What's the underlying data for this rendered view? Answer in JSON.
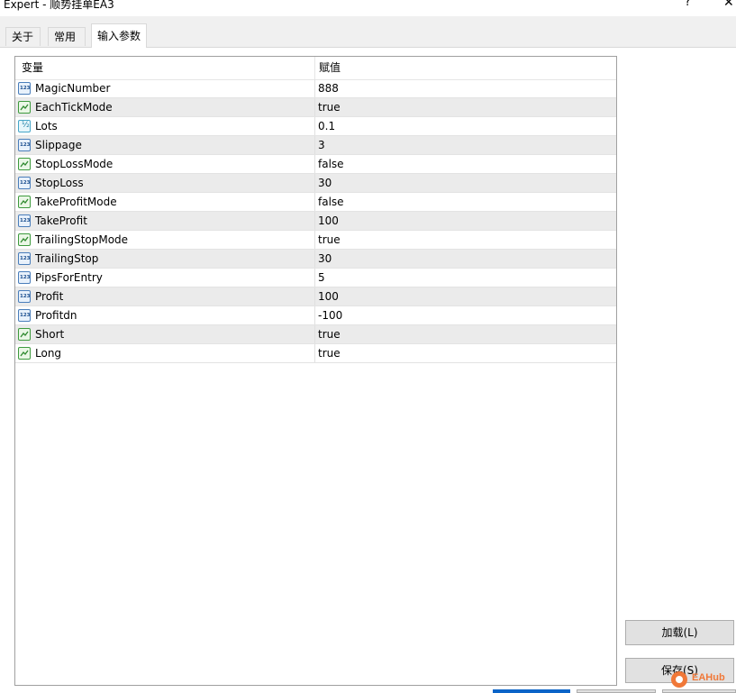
{
  "window": {
    "title": "Expert - 顺势挂单EA3",
    "help_label": "?",
    "close_label": "✕"
  },
  "tabs": [
    {
      "label": "关于"
    },
    {
      "label": "常用"
    },
    {
      "label": "输入参数",
      "active": true
    }
  ],
  "grid": {
    "columns": {
      "variable": "变量",
      "value": "赋值"
    },
    "rows": [
      {
        "icon": "int-icon",
        "name": "MagicNumber",
        "value": "888"
      },
      {
        "icon": "bool-icon",
        "name": "EachTickMode",
        "value": "true"
      },
      {
        "icon": "double-icon",
        "name": "Lots",
        "value": "0.1"
      },
      {
        "icon": "int-icon",
        "name": "Slippage",
        "value": "3"
      },
      {
        "icon": "bool-icon",
        "name": "StopLossMode",
        "value": "false"
      },
      {
        "icon": "int-icon",
        "name": "StopLoss",
        "value": "30"
      },
      {
        "icon": "bool-icon",
        "name": "TakeProfitMode",
        "value": "false"
      },
      {
        "icon": "int-icon",
        "name": "TakeProfit",
        "value": "100"
      },
      {
        "icon": "bool-icon",
        "name": "TrailingStopMode",
        "value": "true"
      },
      {
        "icon": "int-icon",
        "name": "TrailingStop",
        "value": "30"
      },
      {
        "icon": "int-icon",
        "name": "PipsForEntry",
        "value": "5"
      },
      {
        "icon": "int-icon",
        "name": "Profit",
        "value": "100"
      },
      {
        "icon": "int-icon",
        "name": "Profitdn",
        "value": "-100"
      },
      {
        "icon": "bool-icon",
        "name": "Short",
        "value": "true"
      },
      {
        "icon": "bool-icon",
        "name": "Long",
        "value": "true"
      }
    ]
  },
  "buttons": {
    "load": "加载(L)",
    "save": "保存(S)"
  },
  "watermark": {
    "text": "EAHub"
  },
  "colors": {
    "alt_row": "#ebebeb",
    "grid_border": "#a0a0a0",
    "accent_blue": "#0a64c8",
    "watermark_orange": "#f07838"
  }
}
